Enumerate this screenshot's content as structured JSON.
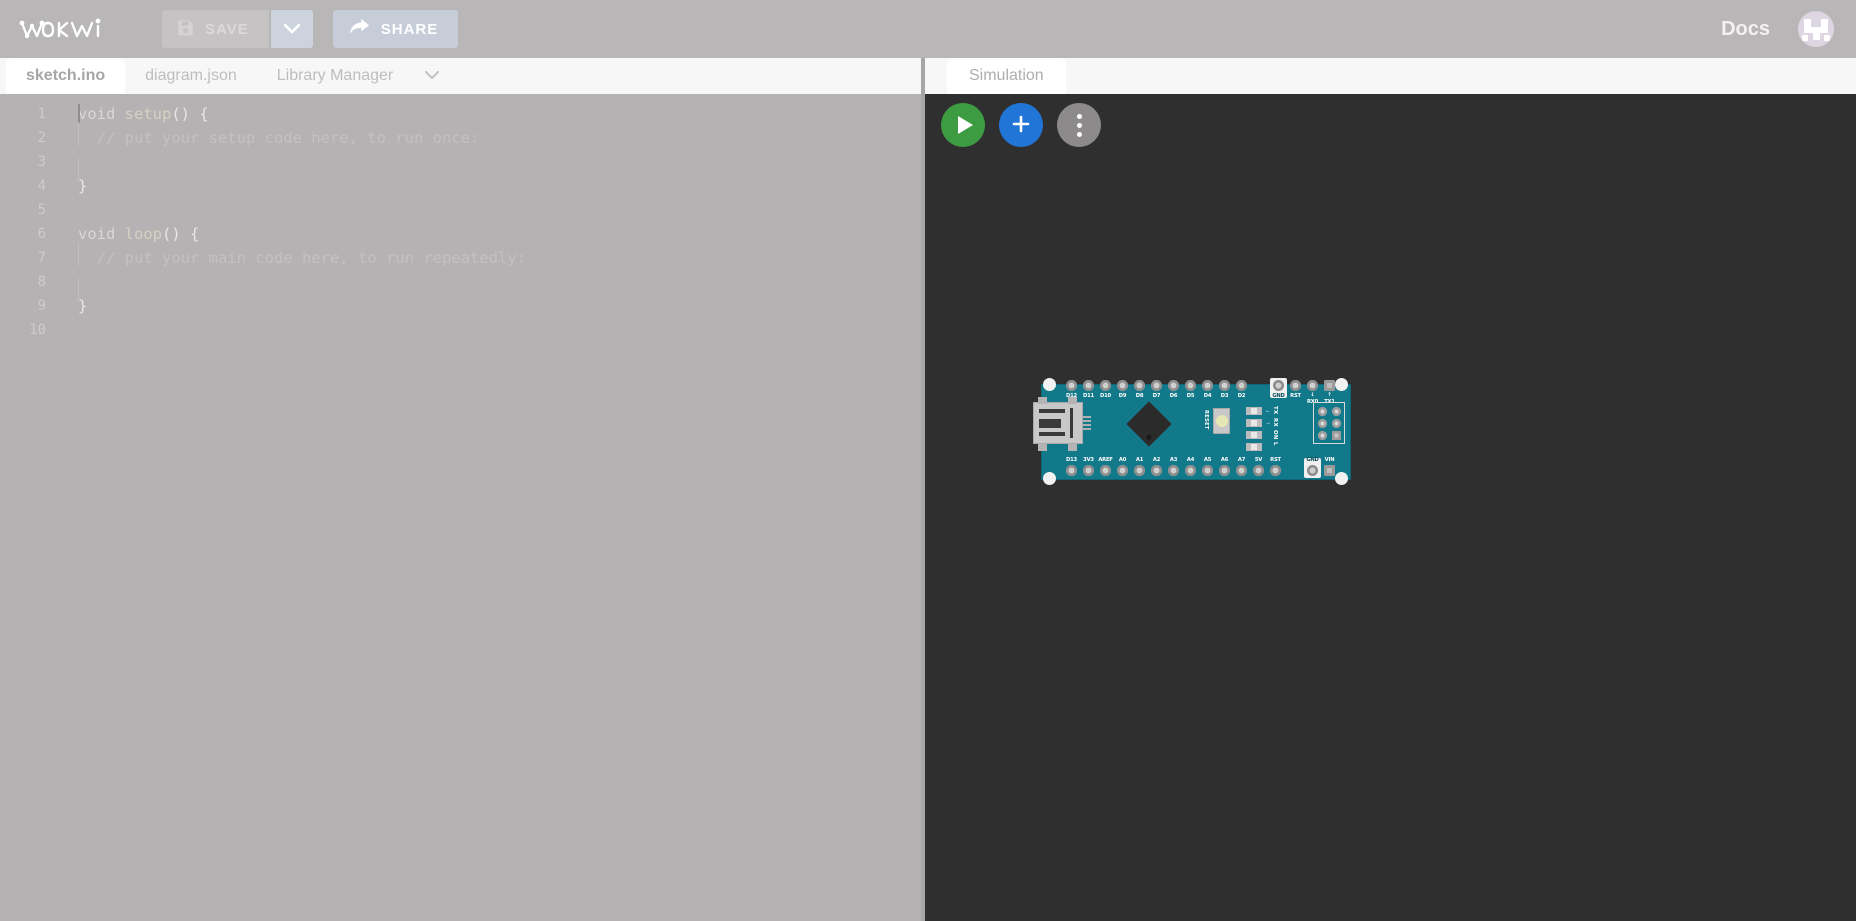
{
  "toolbar": {
    "logo_text": "WOKWI",
    "save_label": "SAVE",
    "save_caret_icon": "chevron-down-icon",
    "save_icon": "floppy-disk-icon",
    "share_label": "SHARE",
    "share_icon": "share-arrow-icon",
    "docs_label": "Docs",
    "avatar_name": "user-avatar"
  },
  "editor": {
    "tabs": [
      {
        "label": "sketch.ino",
        "active": true
      },
      {
        "label": "diagram.json",
        "active": false
      },
      {
        "label": "Library Manager",
        "active": false
      }
    ],
    "overflow_icon": "chevron-down-icon",
    "filename": "sketch.ino",
    "lines": [
      {
        "num": "1",
        "kw": "void ",
        "fn": "setup",
        "pl": "() {",
        "cm": ""
      },
      {
        "num": "2",
        "kw": "",
        "fn": "",
        "pl": "",
        "cm": "  // put your setup code here, to run once:"
      },
      {
        "num": "3",
        "kw": "",
        "fn": "",
        "pl": "",
        "cm": ""
      },
      {
        "num": "4",
        "kw": "",
        "fn": "",
        "pl": "}",
        "cm": ""
      },
      {
        "num": "5",
        "kw": "",
        "fn": "",
        "pl": "",
        "cm": ""
      },
      {
        "num": "6",
        "kw": "void ",
        "fn": "loop",
        "pl": "() {",
        "cm": ""
      },
      {
        "num": "7",
        "kw": "",
        "fn": "",
        "pl": "",
        "cm": "  // put your main code here, to run repeatedly:"
      },
      {
        "num": "8",
        "kw": "",
        "fn": "",
        "pl": "",
        "cm": ""
      },
      {
        "num": "9",
        "kw": "",
        "fn": "",
        "pl": "}",
        "cm": ""
      },
      {
        "num": "10",
        "kw": "",
        "fn": "",
        "pl": "",
        "cm": ""
      }
    ]
  },
  "simulation": {
    "tab_label": "Simulation",
    "actions": [
      {
        "name": "start-simulation-button",
        "icon": "play-icon",
        "color": "#3d9c42"
      },
      {
        "name": "add-part-button",
        "icon": "plus-icon",
        "color": "#2075d6"
      },
      {
        "name": "more-options-button",
        "icon": "kebab-menu-icon",
        "color": "#8c8a8a"
      }
    ],
    "board": {
      "name": "Arduino Nano",
      "pcb_color": "#12798b",
      "top_pins": [
        "D12",
        "D11",
        "D10",
        "D9",
        "D8",
        "D7",
        "D6",
        "D5",
        "D4",
        "D3",
        "D2",
        "GND",
        "RST",
        "RX0",
        "TX1"
      ],
      "top_highlight": "GND",
      "top_arrows": {
        "RX0": "↓",
        "TX1": "↑"
      },
      "bottom_pins": [
        "D13",
        "3V3",
        "AREF",
        "A0",
        "A1",
        "A2",
        "A3",
        "A4",
        "A5",
        "A6",
        "A7",
        "5V",
        "RST",
        "GND",
        "VIN"
      ],
      "bottom_highlight": "GND",
      "reset_label": "RESET",
      "leds": [
        {
          "label": "TX",
          "arrow": "←"
        },
        {
          "label": "RX",
          "arrow": "→"
        },
        {
          "label": "ON",
          "arrow": ""
        },
        {
          "label": "L",
          "arrow": ""
        }
      ]
    }
  },
  "colors": {
    "toolbar_bg": "#b9b6b7",
    "editor_overlay": "#b4b2b2",
    "sim_bg": "#2f2f2f",
    "accent_green": "#3d9c42",
    "accent_blue": "#2075d6",
    "board_teal": "#12798b"
  }
}
